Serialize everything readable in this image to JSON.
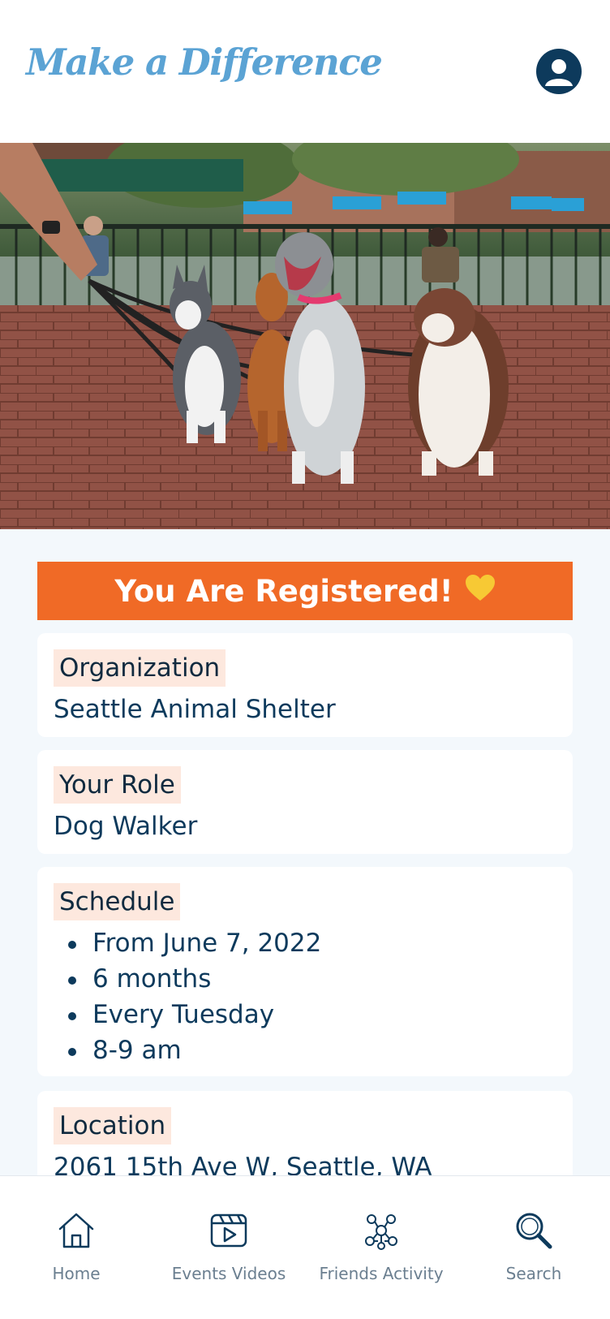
{
  "header": {
    "brand": "Make a Difference",
    "profile_icon": "user-avatar-icon"
  },
  "hero": {
    "image": "dogs-on-leashes-photo"
  },
  "banner": {
    "text": "You Are Registered!",
    "icon": "yellow-heart-icon",
    "color": "#f06a26"
  },
  "organization": {
    "label": "Organization",
    "value": "Seattle Animal Shelter"
  },
  "role": {
    "label": "Your Role",
    "value": "Dog Walker"
  },
  "schedule": {
    "label": "Schedule",
    "items": [
      "From June 7, 2022",
      "6 months",
      "Every Tuesday",
      "8-9 am"
    ]
  },
  "location": {
    "label": "Location",
    "value": "2061 15th Ave W, Seattle, WA"
  },
  "nav": {
    "items": [
      {
        "label": "Home",
        "icon": "home-icon"
      },
      {
        "label": "Events Videos",
        "icon": "video-icon"
      },
      {
        "label": "Friends Activity",
        "icon": "network-icon"
      },
      {
        "label": "Search",
        "icon": "search-icon"
      }
    ]
  },
  "colors": {
    "accent": "#f06a26",
    "brand": "#5ba3d4",
    "navy": "#0d3a5c",
    "label_bg": "#fde8de"
  }
}
